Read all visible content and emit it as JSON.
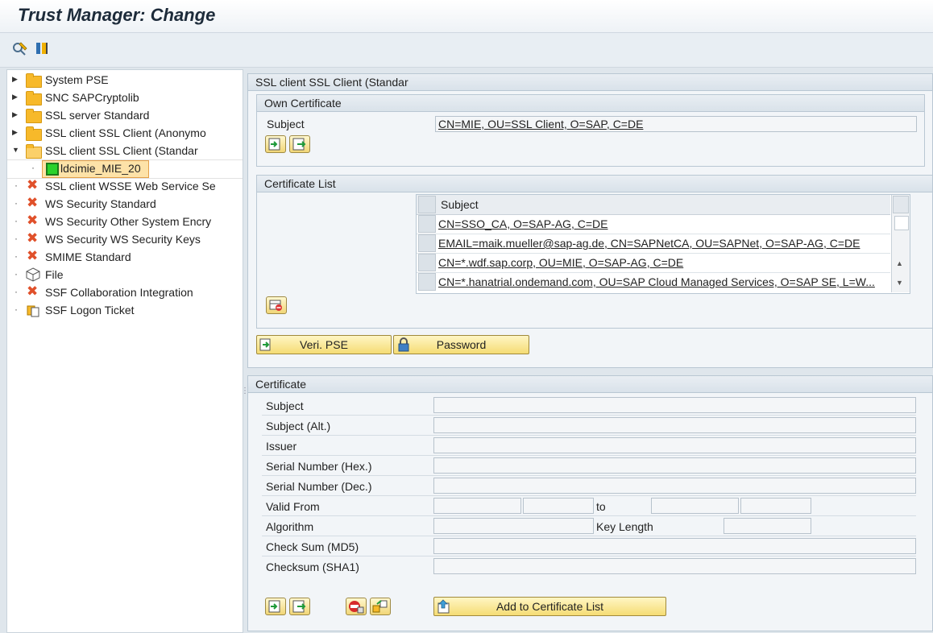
{
  "window": {
    "title": "Trust Manager: Change"
  },
  "toolbar": {
    "icons": [
      "display-change-icon",
      "where-used-icon"
    ]
  },
  "tree": {
    "items": [
      {
        "label": "System PSE",
        "icon": "folder",
        "arrow": "▸"
      },
      {
        "label": "SNC SAPCryptolib",
        "icon": "folder",
        "arrow": "▸"
      },
      {
        "label": "SSL server Standard",
        "icon": "folder",
        "arrow": "▸"
      },
      {
        "label": "SSL client SSL Client (Anonymo",
        "icon": "folder",
        "arrow": "▸"
      },
      {
        "label": "SSL client SSL Client (Standar",
        "icon": "folder-open",
        "arrow": "▾"
      },
      {
        "label": "ldcimie_MIE_20",
        "icon": "green-square",
        "selected": true
      },
      {
        "label": "SSL client WSSE Web Service Se",
        "icon": "red-x"
      },
      {
        "label": "WS Security Standard",
        "icon": "red-x"
      },
      {
        "label": "WS Security Other System Encry",
        "icon": "red-x"
      },
      {
        "label": "WS Security WS Security Keys",
        "icon": "red-x"
      },
      {
        "label": "SMIME Standard",
        "icon": "red-x"
      },
      {
        "label": "File",
        "icon": "cube"
      },
      {
        "label": "SSF Collaboration Integration",
        "icon": "red-x"
      },
      {
        "label": "SSF Logon Ticket",
        "icon": "ticket"
      }
    ]
  },
  "pse_panel": {
    "title": "SSL client SSL Client (Standar",
    "own_certificate": {
      "title": "Own Certificate",
      "subject_label": "Subject",
      "subject_value": "CN=MIE, OU=SSL Client, O=SAP, C=DE"
    },
    "certificate_list": {
      "title": "Certificate List",
      "column_header": "Subject",
      "rows": [
        "CN=SSO_CA, O=SAP-AG, C=DE",
        "EMAIL=maik.mueller@sap-ag.de, CN=SAPNetCA, OU=SAPNet, O=SAP-AG, C=DE",
        "CN=*.wdf.sap.corp, OU=MIE, O=SAP-AG, C=DE",
        "CN=*.hanatrial.ondemand.com, OU=SAP Cloud Managed Services, O=SAP SE, L=W..."
      ]
    },
    "buttons": {
      "veri_pse": "Veri. PSE",
      "password": "Password"
    }
  },
  "certificate_panel": {
    "title": "Certificate",
    "fields": {
      "subject": "Subject",
      "subject_alt": "Subject (Alt.)",
      "issuer": "Issuer",
      "serial_hex": "Serial Number (Hex.)",
      "serial_dec": "Serial Number (Dec.)",
      "valid_from": "Valid From",
      "to": "to",
      "algorithm": "Algorithm",
      "key_length": "Key Length",
      "checksum_md5": "Check Sum (MD5)",
      "checksum_sha1": "Checksum (SHA1)"
    },
    "add_button": "Add to Certificate List"
  },
  "colors": {
    "accent_button": "#f5dc74",
    "panel_bg": "#f2f5f8",
    "error_icon": "#e0502a"
  }
}
